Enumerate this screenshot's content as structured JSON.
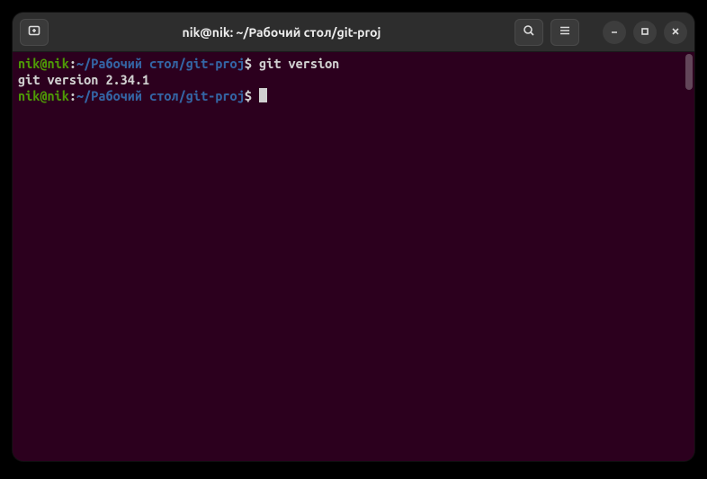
{
  "window": {
    "title": "nik@nik: ~/Рабочий стол/git-proj"
  },
  "prompt1": {
    "user": "nik@nik",
    "sep": ":",
    "path": "~/Рабочий стол/git-proj",
    "sigil": "$",
    "command": "git version"
  },
  "output1": "git version 2.34.1",
  "prompt2": {
    "user": "nik@nik",
    "sep": ":",
    "path": "~/Рабочий стол/git-proj",
    "sigil": "$"
  },
  "colors": {
    "bg": "#2c001e",
    "user": "#4e9a06",
    "path": "#3465a4",
    "text": "#d0d0d0",
    "titlebar": "#2d2d2d"
  }
}
